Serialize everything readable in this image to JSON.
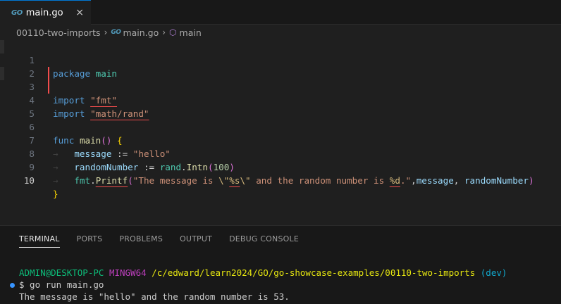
{
  "tab": {
    "icon": "go-icon",
    "label": "main.go",
    "close": "×"
  },
  "breadcrumb": {
    "folder": "00110-two-imports",
    "file": "main.go",
    "symbol": "main"
  },
  "editor": {
    "line_numbers": [
      "1",
      "2",
      "3",
      "4",
      "5",
      "6",
      "7",
      "8",
      "9",
      "10"
    ],
    "lines": {
      "l1": {
        "kw": "package",
        "name": "main"
      },
      "l3": {
        "kw": "import",
        "str": "\"fmt\""
      },
      "l4": {
        "kw": "import",
        "str": "\"math/rand\""
      },
      "l6": {
        "kw": "func",
        "fn": "main",
        "open": "()",
        "brace": "{"
      },
      "l7": {
        "var": "message",
        "op": ":=",
        "str": "\"hello\""
      },
      "l8": {
        "var": "randomNumber",
        "op": ":=",
        "pkg": "rand",
        "fn": "Intn",
        "open": "(",
        "num": "100",
        "close": ")"
      },
      "l9": {
        "pkg": "fmt",
        "fn": "Printf",
        "open": "(",
        "str1": "\"The message is ",
        "esc1": "\\\"",
        "fmt1": "%s",
        "esc2": "\\\"",
        "str2": " and the random number is ",
        "fmt2": "%d",
        "str3": ".\"",
        "comma1": ",",
        "arg1": "message",
        "comma2": ", ",
        "arg2": "randomNumber",
        "close": ")"
      },
      "l10": {
        "brace": "}"
      }
    }
  },
  "panel": {
    "tabs": [
      "TERMINAL",
      "PORTS",
      "PROBLEMS",
      "OUTPUT",
      "DEBUG CONSOLE"
    ],
    "terminal": {
      "user": "ADMIN@DESKTOP-PC",
      "shell": "MINGW64",
      "path": "/c/edward/learn2024/GO/go-showcase-examples/00110-two-imports",
      "branch": "(dev)",
      "command": "$ go run main.go",
      "output": "The message is \"hello\" and the random number is 53."
    }
  }
}
